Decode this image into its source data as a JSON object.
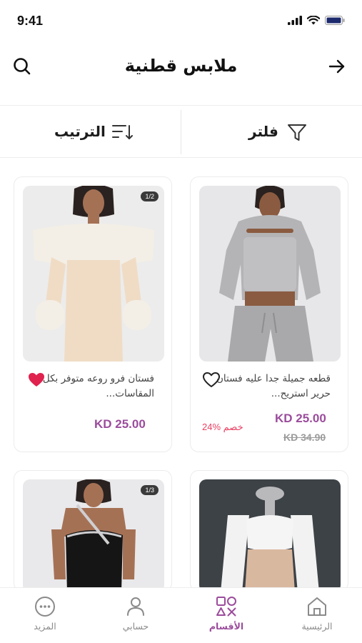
{
  "status": {
    "time": "9:41"
  },
  "header": {
    "title": "ملابس قطنية"
  },
  "toolbar": {
    "sort_label": "الترتيب",
    "filter_label": "فلتر"
  },
  "products": [
    {
      "title": "قطعه جميلة جدا عليه فستان حرير استريح...",
      "price": "KD 25.00",
      "old_price": "KD 34.90",
      "discount": "24% خصم",
      "favorited": false,
      "image_badge": ""
    },
    {
      "title": "فستان فرو روعه متوفر بكل المقاسات...",
      "price": "KD 25.00",
      "favorited": true,
      "image_badge": "1/2"
    },
    {
      "title": "",
      "image_badge": ""
    },
    {
      "title": "",
      "image_badge": "1/3"
    }
  ],
  "bottom_nav": {
    "items": [
      {
        "label": "الرئيسية",
        "icon": "home-icon",
        "active": false
      },
      {
        "label": "الأقسام",
        "icon": "categories-icon",
        "active": true
      },
      {
        "label": "حسابي",
        "icon": "profile-icon",
        "active": false
      },
      {
        "label": "المزيد",
        "icon": "more-icon",
        "active": false
      }
    ]
  },
  "colors": {
    "accent": "#9b4c9c",
    "discount": "#e94063",
    "favorite": "#e0224e"
  }
}
